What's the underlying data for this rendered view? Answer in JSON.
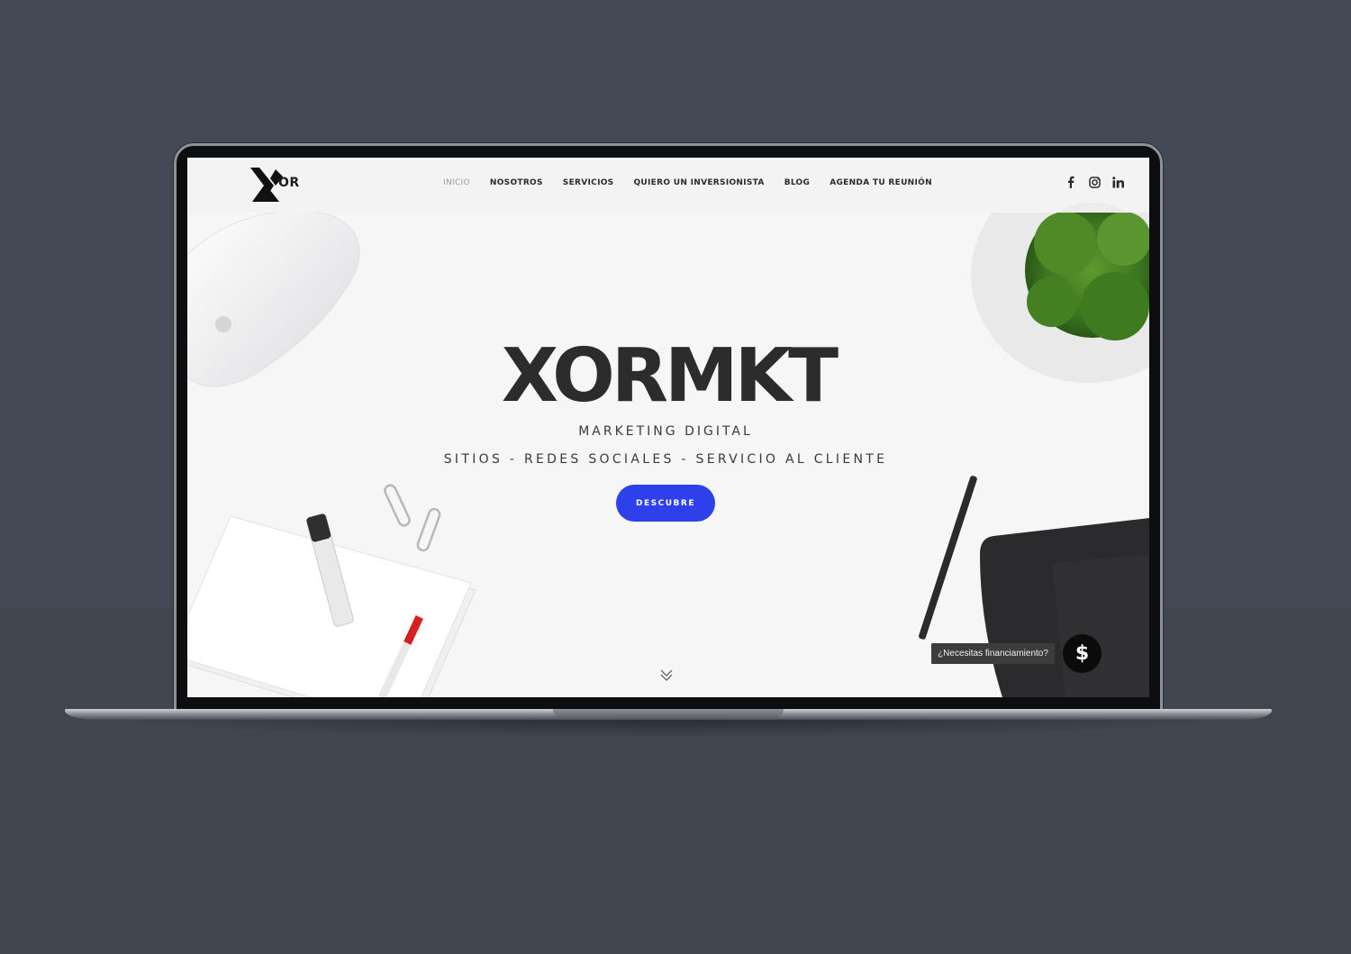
{
  "colors": {
    "background": "#434a55",
    "accent": "#2d40ea",
    "text_dark": "#2c2c2c",
    "nav_active": "#9a9a9a"
  },
  "header": {
    "logo_text": "OR",
    "nav": [
      {
        "label": "INICIO",
        "active": true
      },
      {
        "label": "NOSOTROS",
        "active": false
      },
      {
        "label": "SERVICIOS",
        "active": false
      },
      {
        "label": "QUIERO UN INVERSIONISTA",
        "active": false
      },
      {
        "label": "BLOG",
        "active": false
      },
      {
        "label": "AGENDA TU REUNIÓN",
        "active": false
      }
    ],
    "social": [
      {
        "icon": "facebook-icon",
        "glyph": "f"
      },
      {
        "icon": "instagram-icon",
        "glyph": ""
      },
      {
        "icon": "linkedin-icon",
        "glyph": "in"
      }
    ]
  },
  "hero": {
    "title": "XORMKT",
    "subtitle": "MARKETING DIGITAL",
    "tagline": "SITIOS - REDES SOCIALES - SERVICIO AL CLIENTE",
    "cta_label": "DESCUBRE",
    "scroll_icon": "double-chevron-down-icon"
  },
  "finance_widget": {
    "label": "¿Necesitas financiamiento?",
    "button_glyph": "$"
  }
}
